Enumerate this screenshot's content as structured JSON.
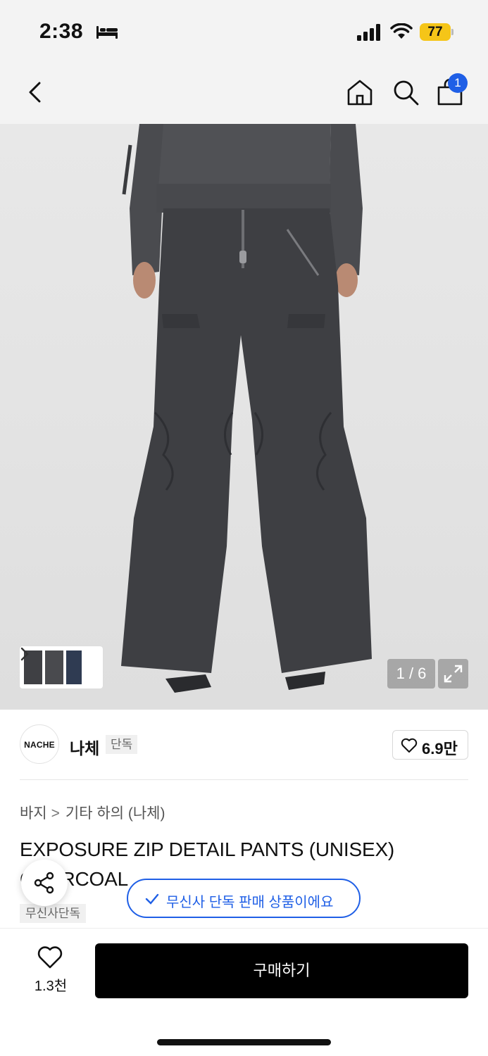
{
  "status_bar": {
    "time": "2:38",
    "battery": "77"
  },
  "nav": {
    "cart_count": "1"
  },
  "gallery": {
    "counter": "1 / 6"
  },
  "brand": {
    "logo_text": "NACHE",
    "name": "나체",
    "badge": "단독",
    "likes": "6.9만"
  },
  "breadcrumb": {
    "level1": "바지",
    "separator": ">",
    "level2": "기타 하의 (나체)"
  },
  "product": {
    "title": "EXPOSURE ZIP DETAIL PANTS (UNISEX) CHARCOAL",
    "tag": "무신사단독"
  },
  "toast": {
    "message": "무신사 단독 판매 상품이에요"
  },
  "bottom_bar": {
    "wish_count": "1.3천",
    "buy_label": "구매하기"
  },
  "colors": {
    "accent": "#1f5fe6",
    "battery": "#f5c518",
    "primary_button": "#000000"
  }
}
